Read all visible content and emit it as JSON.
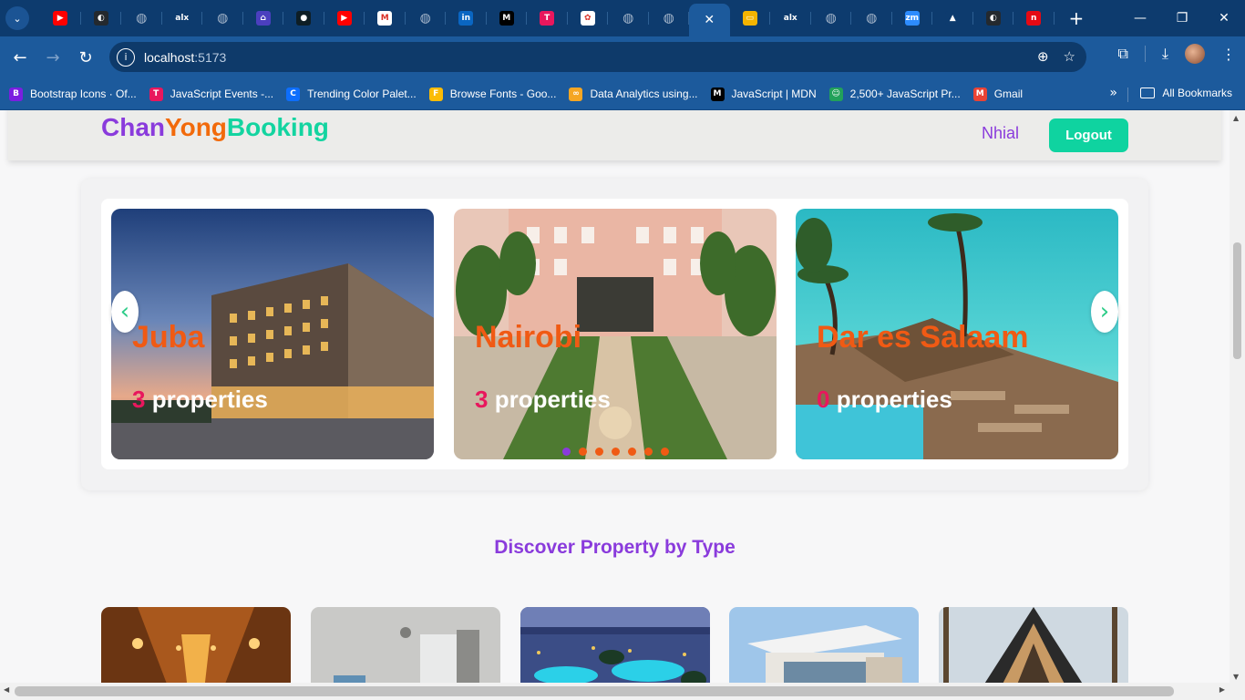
{
  "browser": {
    "tabs": [
      {
        "icon": "youtube-icon",
        "color": "#ff0000",
        "glyph": "▶"
      },
      {
        "icon": "github-icon",
        "color": "#24292e",
        "glyph": "◐"
      },
      {
        "icon": "globe-icon",
        "color": "#5f7a99",
        "glyph": "◍"
      },
      {
        "icon": "alx-icon",
        "color": "#0d3b6e",
        "glyph": "alx"
      },
      {
        "icon": "globe-icon",
        "color": "#5f7a99",
        "glyph": "◍"
      },
      {
        "icon": "app-icon",
        "color": "#4b3fbf",
        "glyph": "⌂"
      },
      {
        "icon": "mongodb-icon",
        "color": "#0e1e25",
        "glyph": "●"
      },
      {
        "icon": "youtube-icon",
        "color": "#ff0000",
        "glyph": "▶"
      },
      {
        "icon": "gmail-icon",
        "color": "#ffffff",
        "glyph": "M"
      },
      {
        "icon": "globe-icon",
        "color": "#5f7a99",
        "glyph": "◍"
      },
      {
        "icon": "linkedin-icon",
        "color": "#0a66c2",
        "glyph": "in"
      },
      {
        "icon": "medium-icon",
        "color": "#000000",
        "glyph": "M"
      },
      {
        "icon": "app-icon",
        "color": "#e8175d",
        "glyph": "T"
      },
      {
        "icon": "chatgpt-icon",
        "color": "#ffffff",
        "glyph": "✿"
      },
      {
        "icon": "globe-icon",
        "color": "#5f7a99",
        "glyph": "◍"
      },
      {
        "icon": "globe-icon",
        "color": "#5f7a99",
        "glyph": "◍"
      },
      {
        "icon": "close-icon",
        "color": "#1c5a9c",
        "glyph": "✕",
        "active": true
      },
      {
        "icon": "slides-icon",
        "color": "#f4b400",
        "glyph": "▭"
      },
      {
        "icon": "alx-icon",
        "color": "#0d3b6e",
        "glyph": "alx"
      },
      {
        "icon": "globe-icon",
        "color": "#5f7a99",
        "glyph": "◍"
      },
      {
        "icon": "globe-icon",
        "color": "#5f7a99",
        "glyph": "◍"
      },
      {
        "icon": "zoom-icon",
        "color": "#2d8cff",
        "glyph": "zm"
      },
      {
        "icon": "drive-icon",
        "color": "#0d3b6e",
        "glyph": "▲"
      },
      {
        "icon": "github-icon",
        "color": "#24292e",
        "glyph": "◐"
      },
      {
        "icon": "app-icon",
        "color": "#e50914",
        "glyph": "n"
      }
    ],
    "url_host": "localhost",
    "url_port": ":5173",
    "bookmarks": [
      {
        "label": "Bootstrap Icons · Of...",
        "icon": "bootstrap-icon",
        "color": "#7b1fe0",
        "glyph": "B"
      },
      {
        "label": "JavaScript Events -...",
        "icon": "app-icon",
        "color": "#e8175d",
        "glyph": "T"
      },
      {
        "label": "Trending Color Palet...",
        "icon": "palette-icon",
        "color": "#0d6efd",
        "glyph": "C"
      },
      {
        "label": "Browse Fonts - Goo...",
        "icon": "google-fonts-icon",
        "color": "#fbbc05",
        "glyph": "F"
      },
      {
        "label": "Data Analytics using...",
        "icon": "infinity-icon",
        "color": "#f5a623",
        "glyph": "∞"
      },
      {
        "label": "JavaScript | MDN",
        "icon": "mdn-icon",
        "color": "#000000",
        "glyph": "M"
      },
      {
        "label": "2,500+ JavaScript Pr...",
        "icon": "app-icon",
        "color": "#22a15a",
        "glyph": "☺"
      },
      {
        "label": "Gmail",
        "icon": "gmail-icon",
        "color": "#ea4335",
        "glyph": "M"
      }
    ],
    "all_bookmarks": "All Bookmarks"
  },
  "navbar": {
    "logo_part1": "Chan",
    "logo_part2": "Yong",
    "logo_part3": "Booking",
    "username": "Nhial",
    "logout_label": "Logout"
  },
  "carousel": {
    "slides": [
      {
        "city": "Juba",
        "count": "3",
        "suffix": " properties"
      },
      {
        "city": "Nairobi",
        "count": "3",
        "suffix": " properties"
      },
      {
        "city": "Dar es Salaam",
        "count": "0",
        "suffix": " properties"
      }
    ],
    "dots": 7,
    "active_dot": 0
  },
  "section": {
    "title": "Discover Property by Type"
  },
  "colors": {
    "brand_purple": "#8a3bdc",
    "brand_orange": "#f26a0b",
    "brand_green": "#13d4a0",
    "count_pink": "#e8175d"
  }
}
